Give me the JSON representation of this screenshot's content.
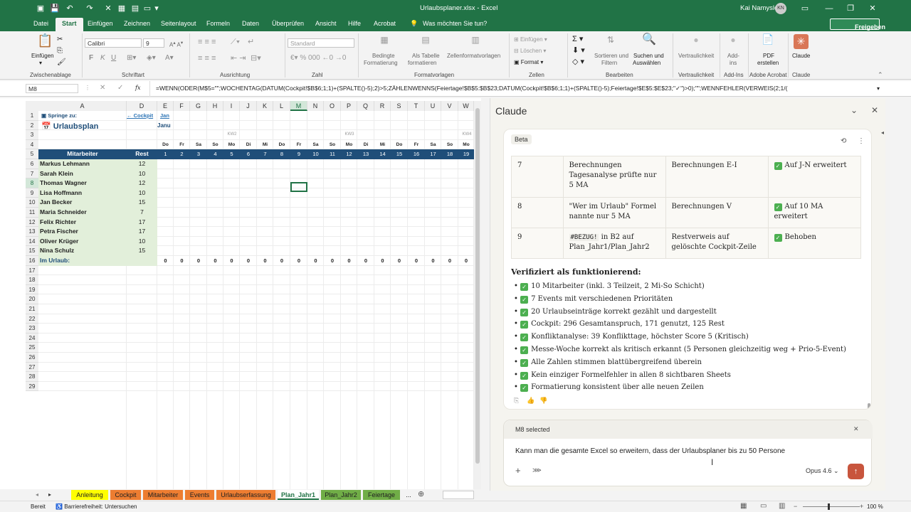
{
  "titlebar": {
    "filename": "Urlaubsplaner.xlsx",
    "sep": " - ",
    "app": "Excel",
    "user": "Kai Namyslo",
    "initials": "KN"
  },
  "menu": {
    "items": [
      "Datei",
      "Start",
      "Einfügen",
      "Zeichnen",
      "Seitenlayout",
      "Formeln",
      "Daten",
      "Überprüfen",
      "Ansicht",
      "Hilfe",
      "Acrobat"
    ],
    "tell_me": "Was möchten Sie tun?",
    "share": "Freigeben"
  },
  "ribbon": {
    "paste": "Einfügen",
    "clipboard": "Zwischenablage",
    "font_name": "Calibri",
    "font_size": "9",
    "font_group": "Schriftart",
    "bold": "F",
    "italic": "K",
    "underline": "U",
    "alignment": "Ausrichtung",
    "number_format": "Standard",
    "number_group": "Zahl",
    "cond_format_1": "Bedingte",
    "cond_format_2": "Formatierung",
    "as_table_1": "Als Tabelle",
    "as_table_2": "formatieren",
    "cell_styles": "Zellenformatvorlagen",
    "styles_group": "Formatvorlagen",
    "insert": "Einfügen",
    "delete": "Löschen",
    "format": "Format",
    "cells_group": "Zellen",
    "sort_1": "Sortieren und",
    "sort_2": "Filtern",
    "find_1": "Suchen und",
    "find_2": "Auswählen",
    "edit_group": "Bearbeiten",
    "sensitivity": "Vertraulichkeit",
    "sensitivity_group": "Vertraulichkeit",
    "addins_1": "Add-",
    "addins_2": "ins",
    "addins_group": "Add-Ins",
    "pdf_1": "PDF",
    "pdf_2": "erstellen",
    "acrobat_group": "Adobe Acrobat",
    "claude_btn": "Claude",
    "claude_group": "Claude"
  },
  "formula_bar": {
    "name_box": "M8",
    "fx": "fx",
    "formula": "=WENN(ODER(M$5=\"\";WOCHENTAG(DATUM(Cockpit!$B$6;1;1)+(SPALTE()-5);2)>5;ZÄHLENWENNS(Feiertage!$B$5:$B$23;DATUM(Cockpit!$B$6;1;1)+(SPALTE()-5);Feiertage!$E$5:$E$23;\"✓\")>0);\"\";WENNFEHLER(VERWEIS(2;1/("
  },
  "sheet": {
    "columns": [
      "A",
      "D",
      "E",
      "F",
      "G",
      "H",
      "I",
      "J",
      "K",
      "L",
      "M",
      "N",
      "O",
      "P",
      "Q",
      "R",
      "S",
      "T",
      "U",
      "V",
      "W"
    ],
    "rows": [
      "1",
      "2",
      "3",
      "4",
      "5",
      "6",
      "7",
      "8",
      "9",
      "10",
      "11",
      "12",
      "13",
      "14",
      "15",
      "16",
      "17",
      "18",
      "19",
      "20",
      "21",
      "22",
      "23",
      "24",
      "25",
      "26",
      "27",
      "28",
      "29"
    ],
    "jump_to": "Springe zu:",
    "cockpit_link": "← Cockpit",
    "jan_link": "Jan",
    "title": "Urlaubsplan",
    "month": "Janu",
    "kw": [
      "KW2",
      "KW3",
      "KW4"
    ],
    "weekdays": [
      "Do",
      "Fr",
      "Sa",
      "So",
      "Mo",
      "Di",
      "Mi",
      "Do",
      "Fr",
      "Sa",
      "So",
      "Mo",
      "Di",
      "Mi",
      "Do",
      "Fr",
      "Sa",
      "So",
      "Mo"
    ],
    "days": [
      "1",
      "2",
      "3",
      "4",
      "5",
      "6",
      "7",
      "8",
      "9",
      "10",
      "11",
      "12",
      "13",
      "14",
      "15",
      "16",
      "17",
      "18",
      "19"
    ],
    "hdr_employee": "Mitarbeiter",
    "hdr_rest": "Rest",
    "employees": [
      {
        "name": "Markus Lehmann",
        "rest": "12"
      },
      {
        "name": "Sarah Klein",
        "rest": "10"
      },
      {
        "name": "Thomas Wagner",
        "rest": "12"
      },
      {
        "name": "Lisa Hoffmann",
        "rest": "10"
      },
      {
        "name": "Jan Becker",
        "rest": "15"
      },
      {
        "name": "Maria Schneider",
        "rest": "7"
      },
      {
        "name": "Felix Richter",
        "rest": "17"
      },
      {
        "name": "Petra Fischer",
        "rest": "17"
      },
      {
        "name": "Oliver Krüger",
        "rest": "10"
      },
      {
        "name": "Nina Schulz",
        "rest": "15"
      }
    ],
    "on_leave": "Im Urlaub:",
    "zero": "0"
  },
  "sheet_tabs": [
    "Anleitung",
    "Cockpit",
    "Mitarbeiter",
    "Events",
    "Urlaubserfassung",
    "Plan_Jahr1",
    "Plan_Jahr2",
    "Feiertage",
    "..."
  ],
  "status": {
    "ready": "Bereit",
    "accessibility": "Barrierefreiheit: Untersuchen",
    "zoom": "100 %"
  },
  "claude": {
    "title": "Claude",
    "badge": "Beta",
    "table": [
      {
        "num": "7",
        "issue": "Berechnungen Tagesanalyse prüfte nur 5 MA",
        "where": "Berechnungen E-I",
        "fix": "Auf J-N erweitert"
      },
      {
        "num": "8",
        "issue": "\"Wer im Urlaub\" Formel nannte nur 5 MA",
        "where": "Berechnungen V",
        "fix": "Auf 10 MA erweitert"
      },
      {
        "num": "9",
        "issue_code": "#BEZUG!",
        "issue_rest": " in B2 auf Plan_Jahr1/Plan_Jahr2",
        "where": "Restverweis auf gelöschte Cockpit-Zeile",
        "fix": "Behoben"
      }
    ],
    "verified_heading": "Verifiziert als funktionierend:",
    "verified": [
      "10 Mitarbeiter (inkl. 3 Teilzeit, 2 Mi-So Schicht)",
      "7 Events mit verschiedenen Prioritäten",
      "20 Urlaubseinträge korrekt gezählt und dargestellt",
      "Cockpit: 296 Gesamtanspruch, 171 genutzt, 125 Rest",
      "Konfliktanalyse: 39 Konflikttage, höchster Score 5 (Kritisch)",
      "Messe-Woche korrekt als kritisch erkannt (5 Personen gleichzeitig weg + Prio-5-Event)",
      "Alle Zahlen stimmen blattübergreifend überein",
      "Kein einziger Formelfehler in allen 8 sichtbaren Sheets",
      "Formatierung konsistent über alle neuen Zeilen"
    ],
    "selection_chip": "M8 selected",
    "input_value": "Kann man die gesamte Excel so erweitern, dass der Urlaubsplaner bis zu 50 Persone",
    "model": "Opus 4.6"
  },
  "colors": {
    "excel_green": "#217346",
    "header_blue": "#1f4e79",
    "light_green": "#e2efda",
    "claude_orange": "#d97757"
  }
}
